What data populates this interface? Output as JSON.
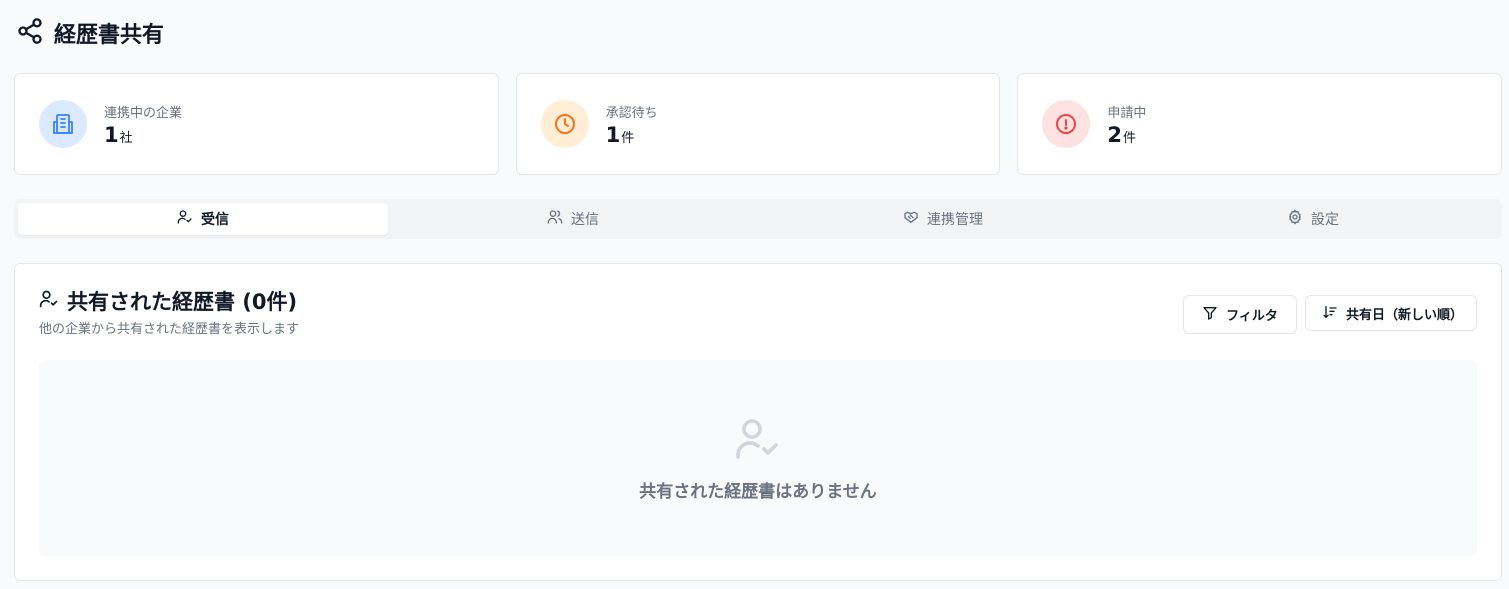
{
  "header": {
    "title": "経歴書共有",
    "icon": "share-icon"
  },
  "stats": [
    {
      "label": "連携中の企業",
      "value": "1",
      "unit": "社",
      "icon": "building-icon",
      "color": "#3b82f6",
      "bg": "#dbeafe"
    },
    {
      "label": "承認待ち",
      "value": "1",
      "unit": "件",
      "icon": "clock-icon",
      "color": "#f97316",
      "bg": "#ffedd5"
    },
    {
      "label": "申請中",
      "value": "2",
      "unit": "件",
      "icon": "alert-circle-icon",
      "color": "#ef4444",
      "bg": "#fee2e2"
    }
  ],
  "tabs": [
    {
      "label": "受信",
      "icon": "user-check-icon",
      "active": true
    },
    {
      "label": "送信",
      "icon": "users-icon",
      "active": false
    },
    {
      "label": "連携管理",
      "icon": "handshake-icon",
      "active": false
    },
    {
      "label": "設定",
      "icon": "gear-icon",
      "active": false
    }
  ],
  "panel": {
    "title": "共有された経歴書 (0件)",
    "description": "他の企業から共有された経歴書を表示します",
    "filter_label": "フィルタ",
    "sort_label": "共有日（新しい順）",
    "empty_text": "共有された経歴書はありません"
  }
}
